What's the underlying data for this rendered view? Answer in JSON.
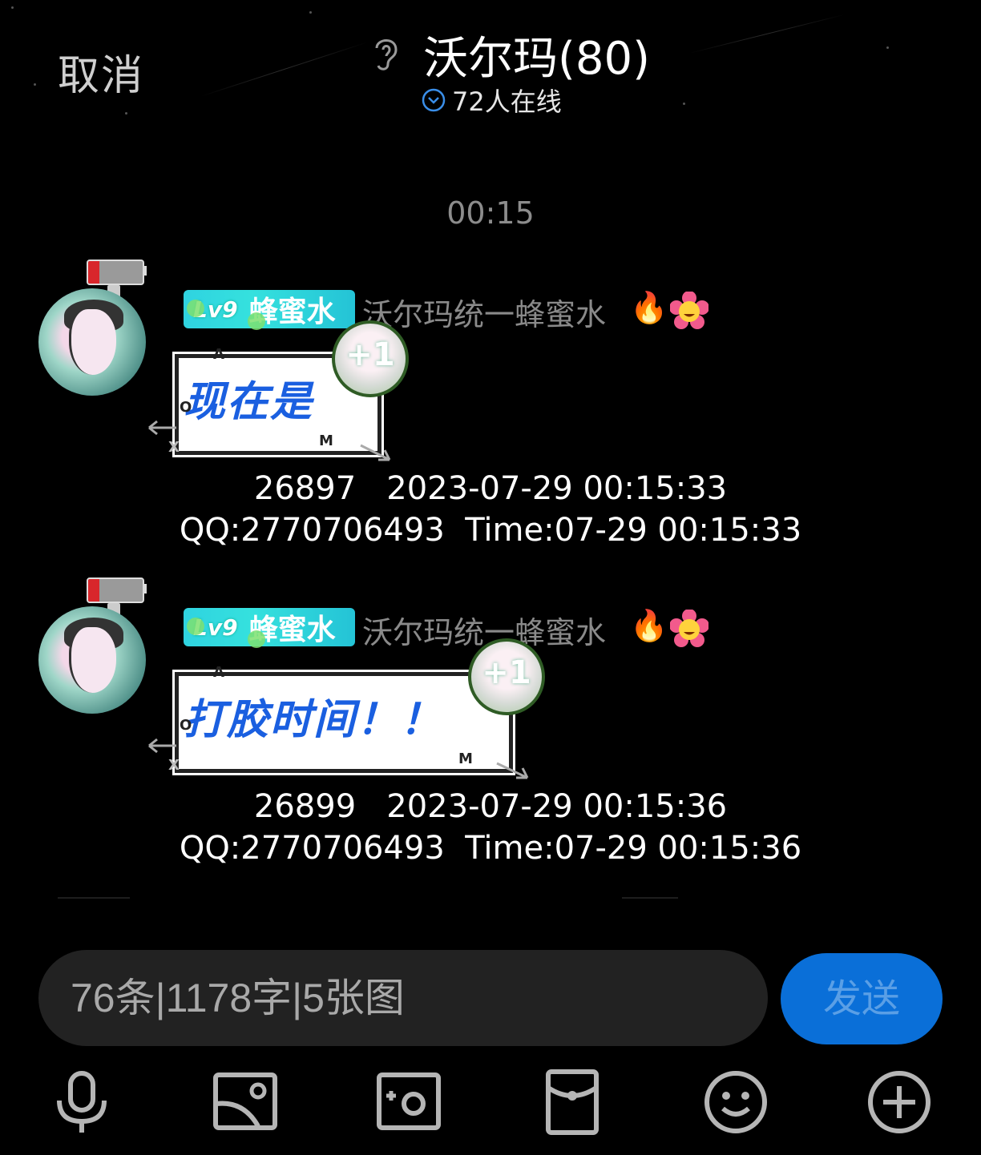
{
  "header": {
    "cancel_label": "取消",
    "title": "沃尔玛(80)",
    "online_text": "72人在线"
  },
  "timestamp": "00:15",
  "messages": [
    {
      "level": "Lv9",
      "badge_name": "蜂蜜水",
      "nickname": "沃尔玛统一蜂蜜水",
      "text": "现在是",
      "plus": "+1",
      "meta_line1": "26897   2023-07-29 00:15:33",
      "meta_line2": "QQ:2770706493  Time:07-29 00:15:33"
    },
    {
      "level": "Lv9",
      "badge_name": "蜂蜜水",
      "nickname": "沃尔玛统一蜂蜜水",
      "text": "打胶时间！！",
      "plus": "+1",
      "meta_line1": "26899   2023-07-29 00:15:36",
      "meta_line2": "QQ:2770706493  Time:07-29 00:15:36"
    }
  ],
  "input": {
    "value": "76条|1178字|5张图"
  },
  "send_label": "发送",
  "toolbar": [
    "microphone-icon",
    "image-icon",
    "camera-icon",
    "red-packet-icon",
    "emoji-icon",
    "plus-icon"
  ],
  "colors": {
    "background": "#000000",
    "send_button": "#0a6fd8",
    "bubble_text": "#1a5fe0",
    "badge": "#2fd3e0"
  }
}
